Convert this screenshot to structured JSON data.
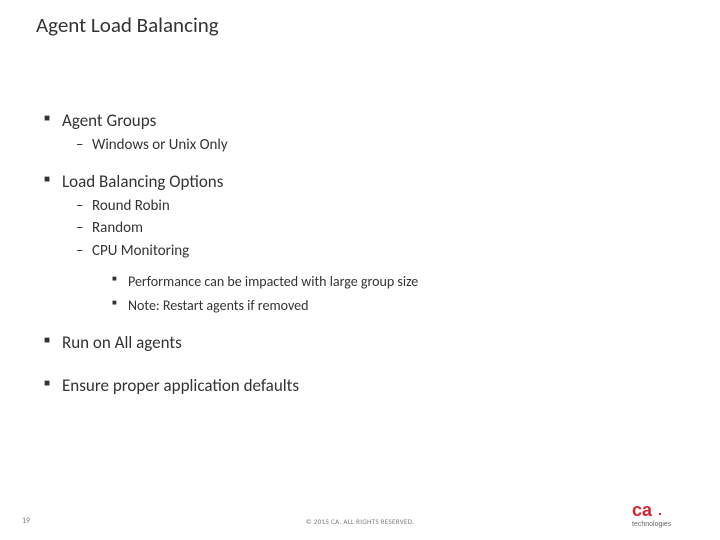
{
  "title": "Agent Load Balancing",
  "bullets": {
    "b1": "Agent Groups",
    "b1_1": "Windows or Unix Only",
    "b2": "Load Balancing Options",
    "b2_1": "Round Robin",
    "b2_2": "Random",
    "b2_3": "CPU Monitoring",
    "b2_3_a": "Performance can be impacted with large group size",
    "b2_3_b": "Note: Restart agents if removed",
    "b3": "Run on All agents",
    "b4": "Ensure proper application defaults"
  },
  "footer": {
    "page": "19",
    "copyright": "© 2015 CA. ALL RIGHTS RESERVED.",
    "logo_sub": "technologies"
  },
  "colors": {
    "ca_red": "#d9262e",
    "text_gray": "#666"
  }
}
